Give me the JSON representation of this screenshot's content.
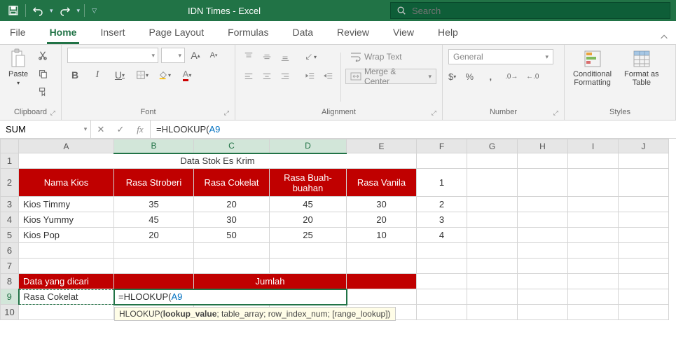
{
  "title": "IDN Times  -  Excel",
  "search_placeholder": "Search",
  "tabs": {
    "file": "File",
    "home": "Home",
    "insert": "Insert",
    "pagelayout": "Page Layout",
    "formulas": "Formulas",
    "data": "Data",
    "review": "Review",
    "view": "View",
    "help": "Help"
  },
  "ribbon": {
    "clipboard": {
      "label": "Clipboard",
      "paste": "Paste"
    },
    "font": {
      "label": "Font",
      "name": "",
      "size": "",
      "bold": "B",
      "italic": "I",
      "underline": "U",
      "grow": "A",
      "shrink": "A"
    },
    "alignment": {
      "label": "Alignment",
      "wrap": "Wrap Text",
      "merge": "Merge & Center"
    },
    "number": {
      "label": "Number",
      "format": "General"
    },
    "styles": {
      "label": "Styles",
      "cond": "Conditional\nFormatting",
      "table": "Format as\nTable"
    }
  },
  "namebox": "SUM",
  "formula": {
    "prefix": "=HLOOKUP(",
    "ref": "A9"
  },
  "tooltip": {
    "fn": "HLOOKUP(",
    "arg1": "lookup_value",
    "rest": "; table_array; row_index_num; [range_lookup])"
  },
  "cols": [
    "A",
    "B",
    "C",
    "D",
    "E",
    "F",
    "G",
    "H",
    "I",
    "J"
  ],
  "sheet": {
    "title": "Data Stok Es Krim",
    "hdr": {
      "a": "Nama Kios",
      "b": "Rasa Stroberi",
      "c": "Rasa Cokelat",
      "d1": "Rasa Buah-",
      "d2": "buahan",
      "e": "Rasa Vanila"
    },
    "rows": [
      {
        "a": "Kios Timmy",
        "b": "35",
        "c": "20",
        "d": "45",
        "e": "30",
        "f": "2"
      },
      {
        "a": "Kios Yummy",
        "b": "45",
        "c": "30",
        "d": "20",
        "e": "20",
        "f": "3"
      },
      {
        "a": "Kios Pop",
        "b": "20",
        "c": "50",
        "d": "25",
        "e": "10",
        "f": "4"
      }
    ],
    "f2": "1",
    "lookup_hdr": {
      "a": "Data yang dicari",
      "cd": "Jumlah"
    },
    "a9": "Rasa Cokelat",
    "b9_prefix": "=HLOOKUP(",
    "b9_ref": "A9"
  }
}
